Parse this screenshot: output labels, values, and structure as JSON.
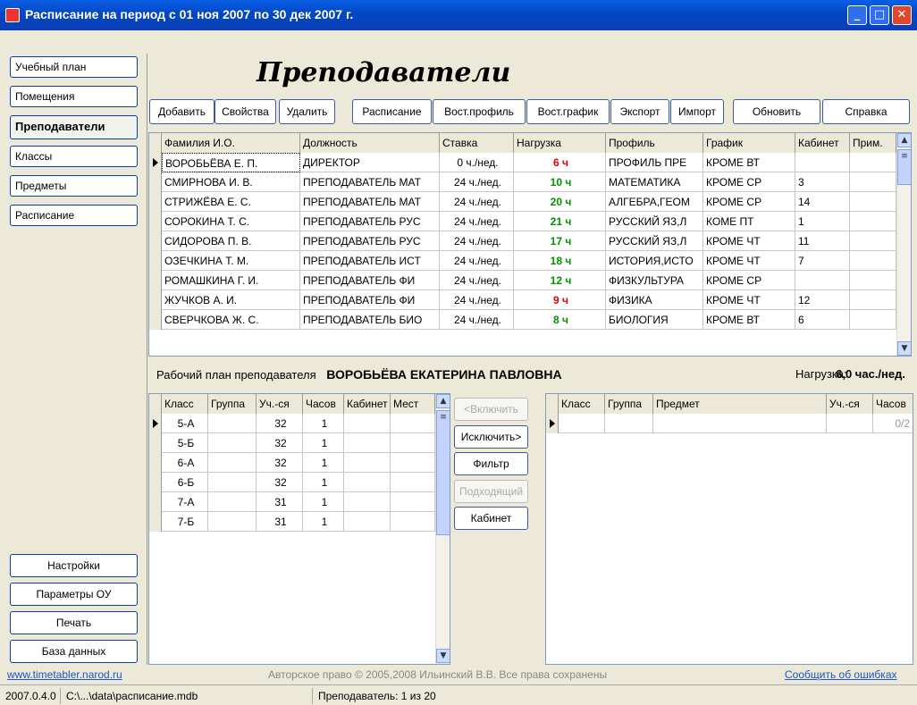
{
  "window": {
    "title": "Расписание на период с 01 ноя 2007 по 30 дек 2007 г."
  },
  "nav": {
    "items": [
      "Учебный план",
      "Помещения",
      "Преподаватели",
      "Классы",
      "Предметы",
      "Расписание"
    ],
    "bottom": [
      "Настройки",
      "Параметры ОУ",
      "Печать",
      "База данных"
    ]
  },
  "page_title": "Преподаватели",
  "toolbar": [
    "Добавить",
    "Свойства",
    "Удалить",
    "Расписание",
    "Вост.профиль",
    "Вост.график",
    "Экспорт",
    "Импорт",
    "Обновить",
    "Справка"
  ],
  "teachers": {
    "columns": [
      "Фамилия И.О.",
      "Должность",
      "Ставка",
      "Нагрузка",
      "Профиль",
      "График",
      "Кабинет",
      "Прим."
    ],
    "rows": [
      [
        "ВОРОБЬЁВА Е. П.",
        "ДИРЕКТОР",
        "0 ч./нед.",
        "6 ч",
        "ПРОФИЛЬ ПРЕ",
        "КРОМЕ ВТ",
        "",
        ""
      ],
      [
        "СМИРНОВА И. В.",
        "ПРЕПОДАВАТЕЛЬ МАТ",
        "24 ч./нед.",
        "10 ч",
        "МАТЕМАТИКА",
        "КРОМЕ СР",
        "3",
        ""
      ],
      [
        "СТРИЖЁВА Е. С.",
        "ПРЕПОДАВАТЕЛЬ МАТ",
        "24 ч./нед.",
        "20 ч",
        "АЛГЕБРА,ГЕОМ",
        "КРОМЕ СР",
        "14",
        ""
      ],
      [
        "СОРОКИНА Т. С.",
        "ПРЕПОДАВАТЕЛЬ РУС",
        "24 ч./нед.",
        "21 ч",
        "РУССКИЙ ЯЗ,Л",
        "КОМЕ ПТ",
        "1",
        ""
      ],
      [
        "СИДОРОВА П. В.",
        "ПРЕПОДАВАТЕЛЬ РУС",
        "24 ч./нед.",
        "17 ч",
        "РУССКИЙ ЯЗ,Л",
        "КРОМЕ ЧТ",
        "11",
        ""
      ],
      [
        "ОЗЕЧКИНА Т. М.",
        "ПРЕПОДАВАТЕЛЬ ИСТ",
        "24 ч./нед.",
        "18 ч",
        "ИСТОРИЯ,ИСТО",
        "КРОМЕ ЧТ",
        "7",
        ""
      ],
      [
        "РОМАШКИНА Г. И.",
        "ПРЕПОДАВАТЕЛЬ ФИ",
        "24 ч./нед.",
        "12 ч",
        "ФИЗКУЛЬТУРА",
        "КРОМЕ СР",
        "",
        ""
      ],
      [
        "ЖУЧКОВ А. И.",
        "ПРЕПОДАВАТЕЛЬ ФИ",
        "24 ч./нед.",
        "9 ч",
        "ФИЗИКА",
        "КРОМЕ ЧТ",
        "12",
        ""
      ],
      [
        "СВЕРЧКОВА Ж. С.",
        "ПРЕПОДАВАТЕЛЬ БИО",
        "24 ч./нед.",
        "8 ч",
        "БИОЛОГИЯ",
        "КРОМЕ ВТ",
        "6",
        ""
      ]
    ]
  },
  "workplan": {
    "label": "Рабочий план преподавателя",
    "teacher": "ВОРОБЬЁВА ЕКАТЕРИНА ПАВЛОВНА",
    "load_label": "Нагрузка:",
    "load_value": "6,0 час./нед."
  },
  "classes": {
    "columns": [
      "Класс",
      "Группа",
      "Уч.-ся",
      "Часов",
      "Кабинет",
      "Мест"
    ],
    "rows": [
      [
        "5-А",
        "",
        "32",
        "1",
        "",
        ""
      ],
      [
        "5-Б",
        "",
        "32",
        "1",
        "",
        ""
      ],
      [
        "6-А",
        "",
        "32",
        "1",
        "",
        ""
      ],
      [
        "6-Б",
        "",
        "32",
        "1",
        "",
        ""
      ],
      [
        "7-А",
        "",
        "31",
        "1",
        "",
        ""
      ],
      [
        "7-Б",
        "",
        "31",
        "1",
        "",
        ""
      ]
    ]
  },
  "actions": [
    "<Включить",
    "Исключить>",
    "Фильтр",
    "Подходящий",
    "Кабинет"
  ],
  "assigned": {
    "columns": [
      "Класс",
      "Группа",
      "Предмет",
      "Уч.-ся",
      "Часов"
    ],
    "first_row_hours": "0/2"
  },
  "footer": {
    "link": "www.timetabler.narod.ru",
    "copyright": "Авторское право © 2005,2008 Ильинский В.В. Все права сохранены",
    "report": "Сообщить об ошибках"
  },
  "status": {
    "version": "2007.0.4.0",
    "path": "C:\\...\\data\\расписание.mdb",
    "record": "Преподаватель: 1 из 20"
  },
  "colors": {
    "load_ok": "#009000",
    "load_low": "#e00000",
    "link": "#1a56c8"
  }
}
